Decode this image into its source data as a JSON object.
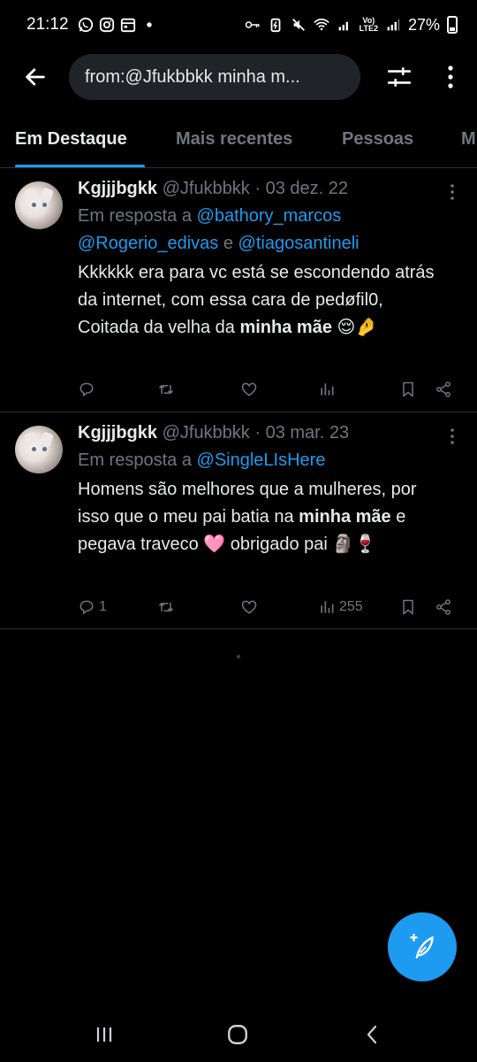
{
  "status_bar": {
    "time": "21:12",
    "battery": "27%",
    "volte_top": "Vo)",
    "volte_bottom": "LTE2"
  },
  "search": {
    "query": "from:@Jfukbbkk  minha m..."
  },
  "tabs": [
    {
      "label": "Em Destaque",
      "active": true
    },
    {
      "label": "Mais recentes",
      "active": false
    },
    {
      "label": "Pessoas",
      "active": false
    },
    {
      "label": "M",
      "active": false
    }
  ],
  "tweets": [
    {
      "name": "Kgjjjbgkk",
      "handle": "@Jfukbbkk · 03 dez. 22",
      "reply_prefix": "Em resposta a ",
      "mention_1": "@bathory_marcos",
      "mention_2": "@Rogerio_edivas",
      "reply_and": " e ",
      "mention_3": "@tiagosantineli",
      "text_1": "Kkkkkk era para vc está se escondendo atrás da internet, com essa cara de pedøfil0, Coitada da velha da ",
      "text_bold_1": "minha mãe",
      "text_2": " 😌🤌",
      "replies": "",
      "views": ""
    },
    {
      "name": "Kgjjjbgkk",
      "handle": "@Jfukbbkk · 03 mar. 23",
      "reply_prefix": "Em resposta a ",
      "mention_1": "@SingleLIsHere",
      "text_1": "Homens são melhores que a mulheres, por isso que o meu pai batia na ",
      "text_bold_1": "minha mãe",
      "text_2": " e pegava traveco 🩷 obrigado pai 🗿🍷",
      "replies": "1",
      "views": "255"
    }
  ],
  "colors": {
    "accent": "#1d9bf0",
    "muted": "#71767b",
    "text": "#e7e9ea",
    "background": "#000000"
  }
}
